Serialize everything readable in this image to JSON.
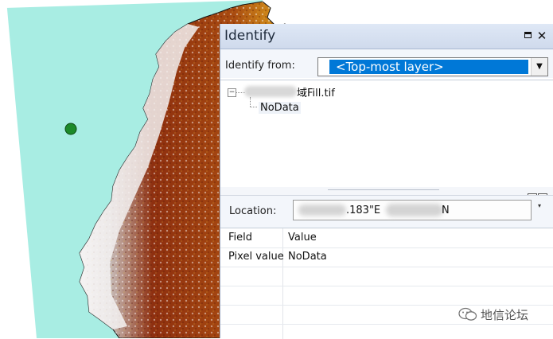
{
  "identify": {
    "title": "Identify",
    "identify_from_label": "Identify from:",
    "identify_from_value": "<Top-most layer>",
    "tree": {
      "layer_name": "域Fill.tif",
      "value": "NoData"
    },
    "location": {
      "label": "Location:",
      "value_part1": ".183\"E",
      "value_part2": "N"
    },
    "table": {
      "headers": [
        "Field",
        "Value"
      ],
      "rows": [
        {
          "field": "Pixel value",
          "value": "NoData"
        }
      ]
    }
  },
  "watermark": {
    "text": "地信论坛"
  },
  "colors": {
    "sea": "#a8ede3",
    "titlebar": "#d5e0f0",
    "selection": "#0078d7",
    "marker": "#1c8a2a"
  },
  "icons": [
    "maximize-icon",
    "close-icon",
    "dropdown-arrow-icon",
    "tree-collapse-icon",
    "wechat-icon"
  ]
}
